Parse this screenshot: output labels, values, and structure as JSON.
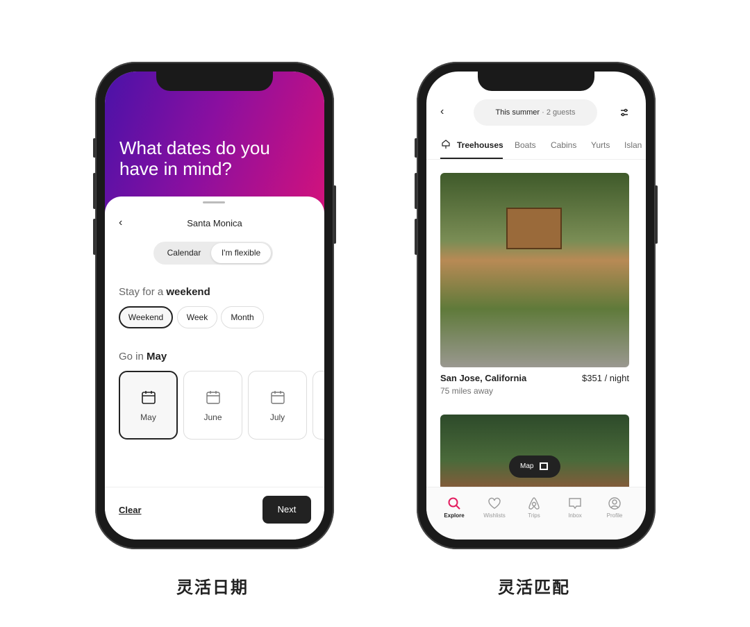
{
  "left_phone": {
    "heading": "What dates do you have in mind?",
    "location": "Santa Monica",
    "toggle": {
      "calendar": "Calendar",
      "flexible": "I'm flexible",
      "active": "flexible"
    },
    "stay_prefix": "Stay for a",
    "stay_value": "weekend",
    "durations": [
      "Weekend",
      "Week",
      "Month"
    ],
    "selected_duration": "Weekend",
    "go_prefix": "Go in",
    "go_value": "May",
    "months": [
      "May",
      "June",
      "July"
    ],
    "selected_month": "May",
    "clear_label": "Clear",
    "next_label": "Next",
    "gradient_colors": [
      "#4a12a8",
      "#d6127a"
    ]
  },
  "right_phone": {
    "search_pill": {
      "primary": "This summer",
      "secondary": "· 2 guests"
    },
    "categories": [
      "Treehouses",
      "Boats",
      "Cabins",
      "Yurts",
      "Islan"
    ],
    "active_category": "Treehouses",
    "listing": {
      "location": "San Jose, California",
      "price": "$351 / night",
      "distance": "75 miles away"
    },
    "map_button": "Map",
    "nav": [
      "Explore",
      "Wishlists",
      "Trips",
      "Inbox",
      "Profile"
    ],
    "active_nav": "Explore",
    "accent_color": "#e31c5f"
  },
  "captions": {
    "left": "灵活日期",
    "right": "灵活匹配"
  }
}
